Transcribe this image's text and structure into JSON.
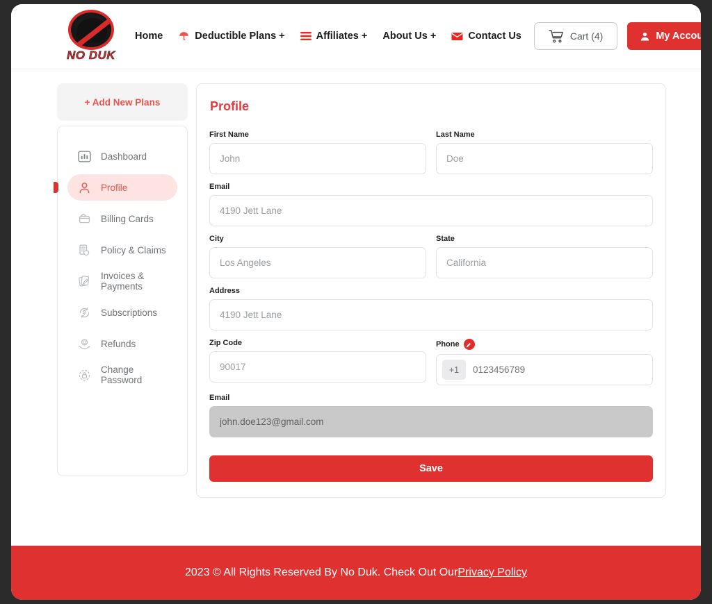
{
  "header": {
    "logo": {
      "text": "NO DUK",
      "alt": "No Duk logo"
    },
    "nav": [
      {
        "label": "Home",
        "icon": ""
      },
      {
        "label": "Deductible Plans +",
        "icon": "umbrella-icon"
      },
      {
        "label": "Affiliates +",
        "icon": "hamburger-icon"
      },
      {
        "label": "About Us +",
        "icon": ""
      },
      {
        "label": "Contact Us",
        "icon": "envelope-icon"
      }
    ],
    "cart_label": "Cart (4)",
    "account_label": "My Account"
  },
  "sidebar": {
    "add_plans_label": "+ Add New Plans",
    "items": [
      {
        "label": "Dashboard",
        "icon": "chart-bar-icon",
        "active": false
      },
      {
        "label": "Profile",
        "icon": "user-icon",
        "active": true
      },
      {
        "label": "Billing Cards",
        "icon": "credit-card-icon",
        "active": false
      },
      {
        "label": "Policy & Claims",
        "icon": "document-shield-icon",
        "active": false
      },
      {
        "label": "Invoices & Payments",
        "icon": "invoice-pen-icon",
        "active": false
      },
      {
        "label": "Subscriptions",
        "icon": "dollar-refresh-icon",
        "active": false
      },
      {
        "label": "Refunds",
        "icon": "hand-coin-icon",
        "active": false
      },
      {
        "label": "Change Password",
        "icon": "lock-circle-icon",
        "active": false
      }
    ]
  },
  "profile": {
    "title": "Profile",
    "fields": {
      "first_name": {
        "label": "First Name",
        "value": "",
        "placeholder": "John"
      },
      "last_name": {
        "label": "Last Name",
        "value": "",
        "placeholder": "Doe"
      },
      "email_top": {
        "label": "Email",
        "value": "",
        "placeholder": "4190 Jett Lane"
      },
      "city": {
        "label": "City",
        "value": "",
        "placeholder": "Los Angeles"
      },
      "state": {
        "label": "State",
        "value": "",
        "placeholder": "California"
      },
      "address": {
        "label": "Address",
        "value": "",
        "placeholder": "4190 Jett Lane"
      },
      "zip_code": {
        "label": "Zip Code",
        "value": "",
        "placeholder": "90017"
      },
      "phone": {
        "label": "Phone",
        "prefix": "+1",
        "value": "",
        "placeholder": "0123456789"
      },
      "email_bottom": {
        "label": "Email",
        "value": "john.doe123@gmail.com",
        "placeholder": "john.doe123@gmail.com"
      }
    },
    "save_label": "Save"
  },
  "footer": {
    "text": "2023 © All Rights Reserved By No Duk. Check Out Our ",
    "link_label": "Privacy Policy"
  },
  "colors": {
    "accent_red": "#e03131",
    "title_red": "#e8393b",
    "active_bg": "#fde3e1",
    "muted_text": "#6f7276",
    "readonly_bg": "#c9c9c9"
  }
}
